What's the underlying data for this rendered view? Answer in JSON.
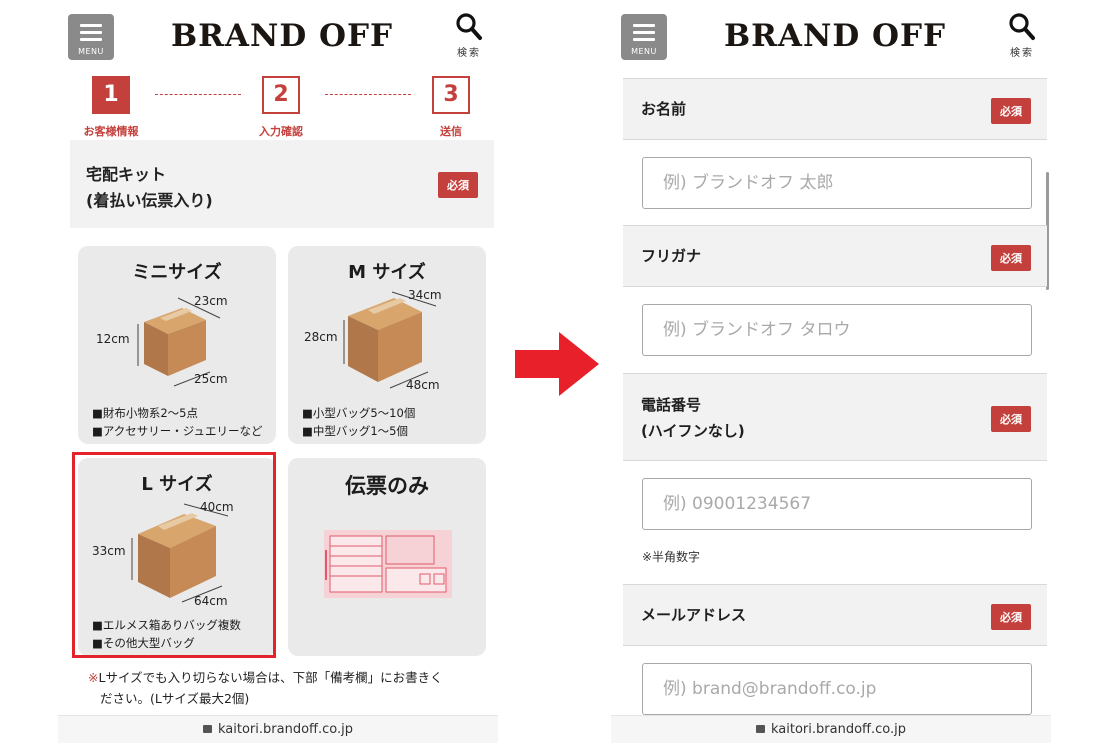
{
  "header": {
    "menu_label": "MENU",
    "logo": "BRAND OFF",
    "search_label": "検索"
  },
  "steps": [
    {
      "num": "1",
      "label": "お客様情報"
    },
    {
      "num": "2",
      "label": "入力確認"
    },
    {
      "num": "3",
      "label": "送信"
    }
  ],
  "kit": {
    "title_line1": "宅配キット",
    "title_line2": "(着払い伝票入り)",
    "required": "必須"
  },
  "sizes": {
    "mini": {
      "title": "ミニサイズ",
      "w": "23cm",
      "h": "12cm",
      "d": "25cm",
      "desc1": "■財布小物系2〜5点",
      "desc2": "■アクセサリー・ジュエリーなど"
    },
    "m": {
      "title": "M サイズ",
      "w": "34cm",
      "h": "28cm",
      "d": "48cm",
      "desc1": "■小型バッグ5〜10個",
      "desc2": "■中型バッグ1〜5個"
    },
    "l": {
      "title": "L サイズ",
      "w": "40cm",
      "h": "33cm",
      "d": "64cm",
      "desc1": "■エルメス箱ありバッグ複数",
      "desc2": "■その他大型バッグ"
    },
    "slip": {
      "title": "伝票のみ"
    }
  },
  "note": {
    "mark": "※",
    "line1": "Lサイズでも入り切らない場合は、下部「備考欄」にお書きく",
    "line2": "ださい。(Lサイズ最大2個)"
  },
  "url": "kaitori.brandoff.co.jp",
  "form": {
    "name": {
      "label": "お名前",
      "required": "必須",
      "placeholder": "例) ブランドオフ 太郎"
    },
    "furigana": {
      "label": "フリガナ",
      "required": "必須",
      "placeholder": "例) ブランドオフ タロウ"
    },
    "phone": {
      "label_line1": "電話番号",
      "label_line2": "(ハイフンなし)",
      "required": "必須",
      "placeholder": "例) 09001234567",
      "hint": "※半角数字"
    },
    "email": {
      "label": "メールアドレス",
      "required": "必須",
      "placeholder": "例) brand@brandoff.co.jp"
    }
  },
  "colors": {
    "accent": "#c4403c",
    "highlight": "#e3232b",
    "arrow": "#e8202a"
  }
}
